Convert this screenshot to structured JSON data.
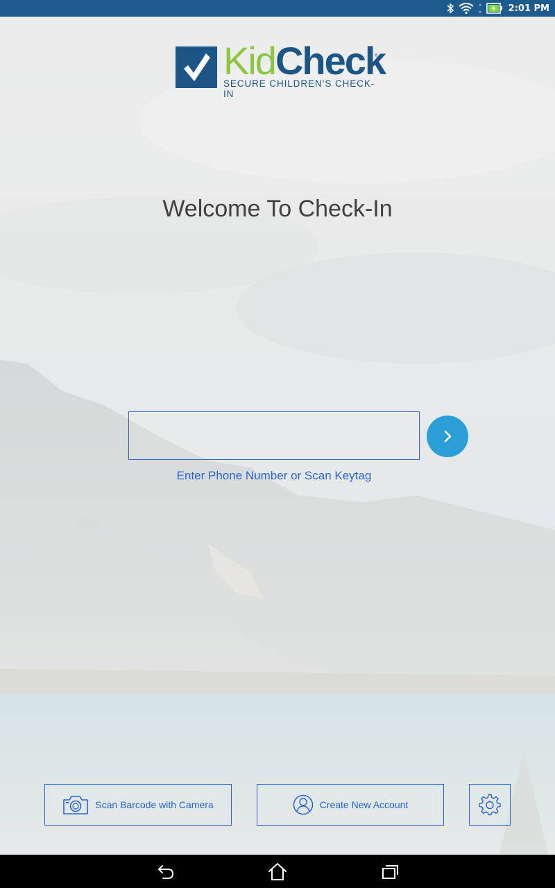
{
  "status_bar": {
    "time": "2:01 PM",
    "icons": [
      "bluetooth-icon",
      "wifi-icon",
      "battery-charging-icon"
    ]
  },
  "logo": {
    "brand_kid": "Kid",
    "brand_check": "Check",
    "registered": "®",
    "tagline": "SECURE CHILDREN’S CHECK-IN",
    "colors": {
      "green": "#8cc63f",
      "blue": "#1b5687"
    }
  },
  "main": {
    "title": "Welcome To Check-In",
    "phone_input": {
      "value": "",
      "placeholder": ""
    },
    "hint": "Enter Phone Number or Scan Keytag",
    "go_button_icon": "chevron-right-icon"
  },
  "actions": {
    "scan_label": "Scan Barcode with Camera",
    "scan_icon": "camera-icon",
    "create_label": "Create New Account",
    "create_icon": "user-circle-icon",
    "settings_icon": "gear-icon"
  },
  "nav_bar": {
    "icons": [
      "back-icon",
      "home-icon",
      "recent-apps-icon"
    ]
  },
  "colors": {
    "accent": "#2c62d6",
    "go_button": "#2a9fd6",
    "status_bar": "#1d5a8e"
  }
}
